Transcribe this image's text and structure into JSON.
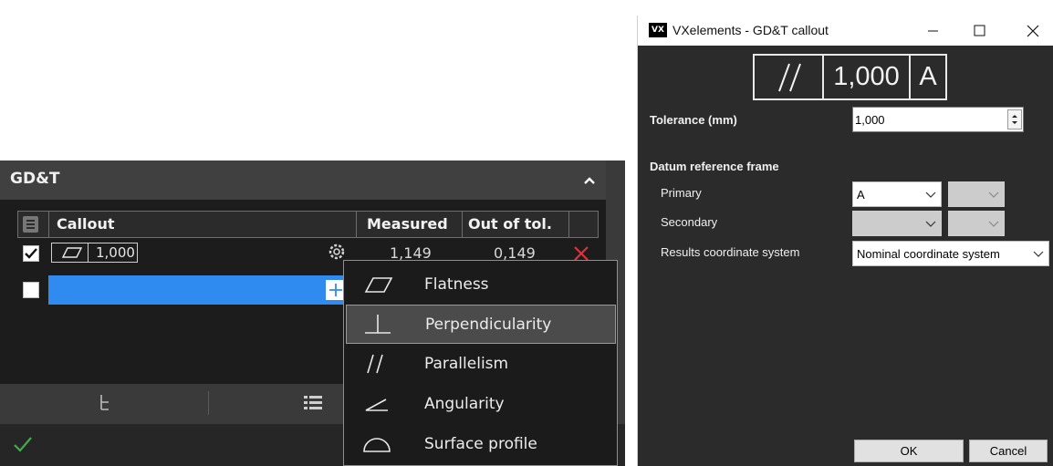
{
  "gdt_panel": {
    "title": "GD&T",
    "table": {
      "headers": {
        "callout": "Callout",
        "measured": "Measured",
        "out_of_tol": "Out of tol."
      },
      "rows": [
        {
          "checked": true,
          "callout_value": "1,000",
          "callout_symbol": "flatness-icon",
          "measured": "1,149",
          "out_of_tol": "0,149"
        },
        {
          "checked": false,
          "callout_value": "",
          "measured": "",
          "out_of_tol": ""
        }
      ]
    },
    "accent_color": "#2f8bf0",
    "delete_color": "#e0313a",
    "ok_color": "#3fae49"
  },
  "context_menu": {
    "items": [
      {
        "label": "Flatness",
        "icon": "flatness-icon"
      },
      {
        "label": "Perpendicularity",
        "icon": "perpendicularity-icon",
        "active": true
      },
      {
        "label": "Parallelism",
        "icon": "parallelism-icon"
      },
      {
        "label": "Angularity",
        "icon": "angularity-icon"
      },
      {
        "label": "Surface profile",
        "icon": "surface-profile-icon"
      }
    ]
  },
  "dialog": {
    "app_icon": "VX",
    "title": "VXelements - GD&T callout",
    "fcf": {
      "symbol": "parallelism-icon",
      "tolerance": "1,000",
      "datum": "A"
    },
    "tolerance_label": "Tolerance (mm)",
    "tolerance_value": "1,000",
    "drf_label": "Datum reference frame",
    "primary_label": "Primary",
    "primary_value": "A",
    "secondary_label": "Secondary",
    "secondary_value": "",
    "results_cs_label": "Results coordinate system",
    "results_cs_value": "Nominal coordinate system",
    "ok_label": "OK",
    "cancel_label": "Cancel"
  }
}
